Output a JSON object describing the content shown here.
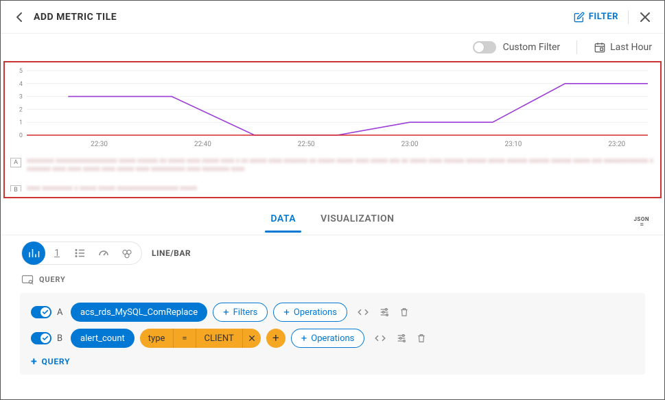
{
  "header": {
    "title": "ADD METRIC TILE",
    "filter_label": "FILTER"
  },
  "subheader": {
    "custom_filter_label": "Custom Filter",
    "time_range_label": "Last Hour",
    "custom_filter_on": false
  },
  "chart_data": {
    "type": "line",
    "ylim": [
      0,
      5
    ],
    "yticks": [
      0,
      1,
      2,
      3,
      4,
      5
    ],
    "xticks": [
      "22:30",
      "22:40",
      "22:50",
      "23:00",
      "23:10",
      "23:20"
    ],
    "series": [
      {
        "name": "A",
        "color": "#9b3dd6",
        "points": [
          {
            "x": "22:27",
            "y": 3
          },
          {
            "x": "22:37",
            "y": 3
          },
          {
            "x": "22:45",
            "y": 0
          },
          {
            "x": "22:53",
            "y": 0
          },
          {
            "x": "23:00",
            "y": 1
          },
          {
            "x": "23:08",
            "y": 1
          },
          {
            "x": "23:15",
            "y": 4
          },
          {
            "x": "23:23",
            "y": 4
          }
        ]
      },
      {
        "name": "B",
        "color": "#d62828",
        "points": [
          {
            "x": "22:23",
            "y": 0
          },
          {
            "x": "23:23",
            "y": 0
          }
        ]
      }
    ]
  },
  "tabs": {
    "data": "DATA",
    "visualization": "VISUALIZATION",
    "json_toggle": "JSON"
  },
  "chart_type": {
    "label": "LINE/BAR"
  },
  "query_section": {
    "label": "QUERY",
    "add_label": "QUERY"
  },
  "queries": {
    "a": {
      "letter": "A",
      "metric": "acs_rds_MySQL_ComReplace",
      "filters_btn": "Filters",
      "operations_btn": "Operations"
    },
    "b": {
      "letter": "B",
      "metric": "alert_count",
      "filter_key": "type",
      "filter_op": "=",
      "filter_val": "CLIENT",
      "operations_btn": "Operations"
    }
  }
}
